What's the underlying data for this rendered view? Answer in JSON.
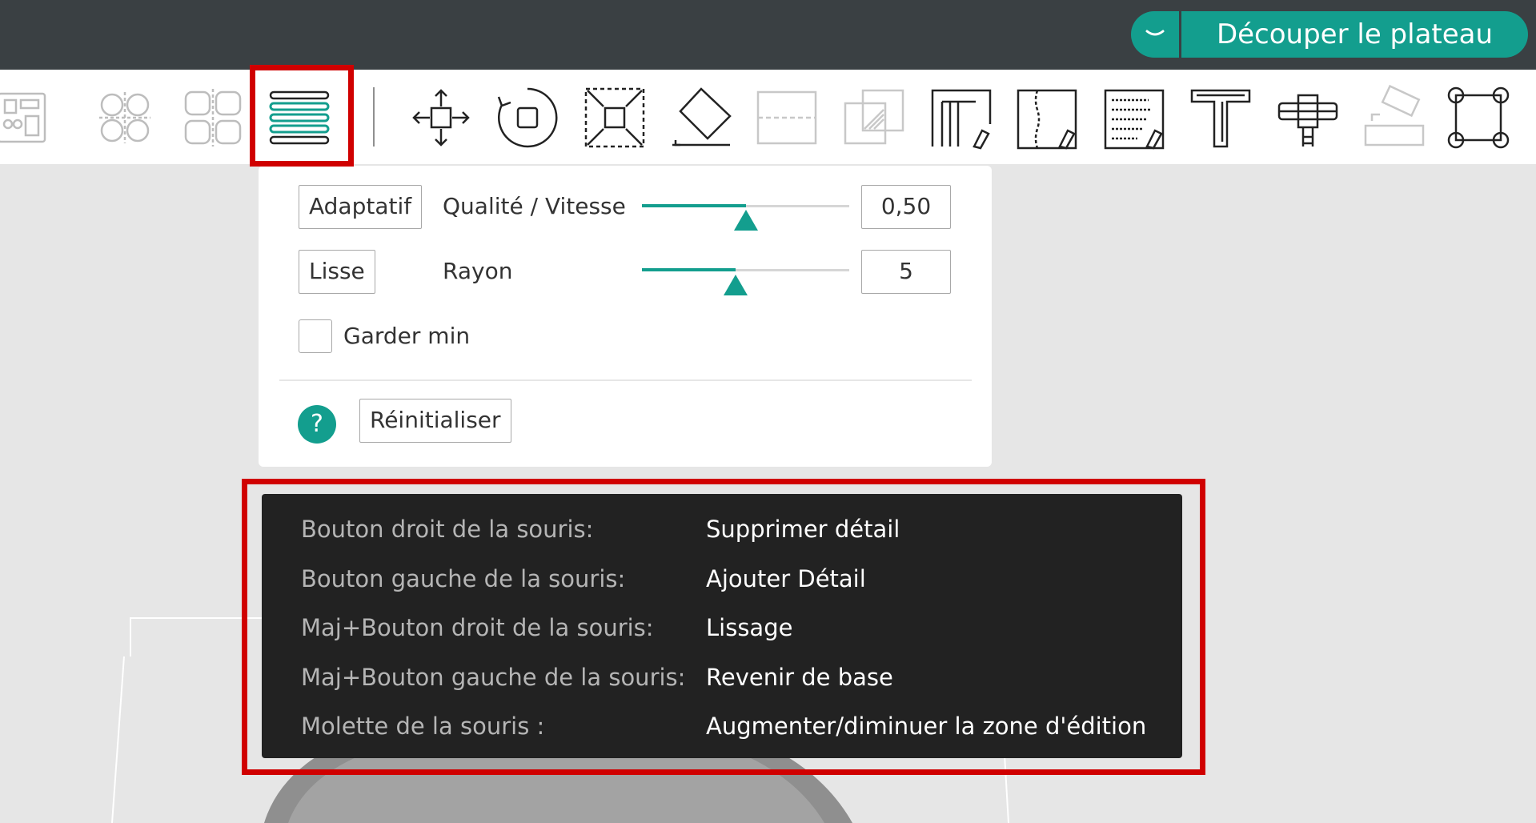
{
  "topbar": {
    "slice_button_label": "Découper le plateau",
    "dropdown_icon": "chevron-down-icon"
  },
  "toolbar": {
    "tools": [
      {
        "name": "arrange-icon"
      },
      {
        "name": "orient-icon"
      },
      {
        "name": "split-icon"
      },
      {
        "name": "variable-layer-height-icon",
        "highlighted": true
      },
      {
        "name": "move-icon"
      },
      {
        "name": "rotate-icon"
      },
      {
        "name": "scale-icon"
      },
      {
        "name": "place-on-face-icon"
      },
      {
        "name": "cut-icon"
      },
      {
        "name": "boolean-icon"
      },
      {
        "name": "support-paint-icon"
      },
      {
        "name": "seam-paint-icon"
      },
      {
        "name": "fuzzy-skin-icon"
      },
      {
        "name": "text-icon"
      },
      {
        "name": "measure-icon"
      },
      {
        "name": "assembly-icon"
      },
      {
        "name": "fit-view-icon"
      }
    ]
  },
  "panel": {
    "adaptive_button": "Adaptatif",
    "quality_label": "Qualité / Vitesse",
    "quality_value": "0,50",
    "quality_fraction": 0.5,
    "smooth_button": "Lisse",
    "radius_label": "Rayon",
    "radius_value": "5",
    "radius_fraction": 0.45,
    "keep_min_label": "Garder min",
    "keep_min_checked": false,
    "reset_button": "Réinitialiser",
    "help_symbol": "?"
  },
  "tooltip": {
    "rows": [
      {
        "key": "Bouton droit de la souris:",
        "value": "Supprimer détail"
      },
      {
        "key": "Bouton gauche de la souris:",
        "value": "Ajouter Détail"
      },
      {
        "key": "Maj+Bouton droit de la souris:",
        "value": "Lissage"
      },
      {
        "key": "Maj+Bouton gauche de la souris:",
        "value": "Revenir de base"
      },
      {
        "key": "Molette de la souris :",
        "value": "Augmenter/diminuer la zone d'édition"
      }
    ]
  },
  "colors": {
    "accent": "#139e8e",
    "topbar": "#3a4043",
    "highlight": "#d00000",
    "tooltip_bg": "#222222"
  }
}
